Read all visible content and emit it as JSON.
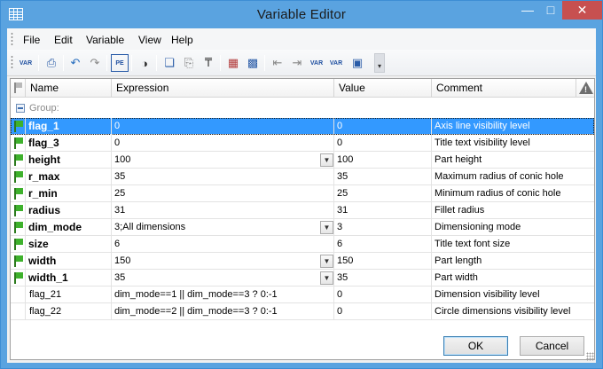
{
  "window": {
    "title": "Variable Editor"
  },
  "menu": [
    "File",
    "Edit",
    "Variable",
    "View",
    "Help"
  ],
  "toolbar": {
    "icons": [
      "add-variable",
      "print",
      "undo",
      "redo",
      "properties",
      "find",
      "copy",
      "paste",
      "clear-format",
      "table-view-1",
      "table-view-2",
      "move-down",
      "move-up",
      "variable-a",
      "variable-b",
      "window"
    ],
    "label_var": "VAR",
    "label_pe": "PE"
  },
  "columns": [
    "Name",
    "Expression",
    "Value",
    "Comment"
  ],
  "group_label": "Group:",
  "rows": [
    {
      "name": "flag_1",
      "expression": "0",
      "value": "0",
      "comment": "Axis line visibility level",
      "flag": true,
      "dropdown": false,
      "selected": true
    },
    {
      "name": "flag_3",
      "expression": "0",
      "value": "0",
      "comment": "Title text visibility level",
      "flag": true,
      "dropdown": false
    },
    {
      "name": "height",
      "expression": "100",
      "value": "100",
      "comment": "Part height",
      "flag": true,
      "dropdown": true
    },
    {
      "name": "r_max",
      "expression": "35",
      "value": "35",
      "comment": "Maximum radius of conic hole",
      "flag": true,
      "dropdown": false
    },
    {
      "name": "r_min",
      "expression": "25",
      "value": "25",
      "comment": "Minimum radius of conic hole",
      "flag": true,
      "dropdown": false
    },
    {
      "name": "radius",
      "expression": "31",
      "value": "31",
      "comment": "Fillet radius",
      "flag": true,
      "dropdown": false
    },
    {
      "name": "dim_mode",
      "expression": "3;All dimensions",
      "value": "3",
      "comment": "Dimensioning mode",
      "flag": true,
      "dropdown": true
    },
    {
      "name": "size",
      "expression": "6",
      "value": "6",
      "comment": "Title text font size",
      "flag": true,
      "dropdown": false
    },
    {
      "name": "width",
      "expression": "150",
      "value": "150",
      "comment": "Part length",
      "flag": true,
      "dropdown": true
    },
    {
      "name": "width_1",
      "expression": "35",
      "value": "35",
      "comment": "Part width",
      "flag": true,
      "dropdown": true
    },
    {
      "name": "flag_21",
      "expression": "dim_mode==1 || dim_mode==3 ? 0:-1",
      "value": "0",
      "comment": "Dimension visibility level",
      "flag": false,
      "dropdown": false
    },
    {
      "name": "flag_22",
      "expression": "dim_mode==2 || dim_mode==3 ? 0:-1",
      "value": "0",
      "comment": "Circle dimensions visibility level",
      "flag": false,
      "dropdown": false
    }
  ],
  "buttons": {
    "ok": "OK",
    "cancel": "Cancel"
  },
  "colors": {
    "titlebar": "#5aa3e0",
    "selection": "#3399ff",
    "close": "#c75050",
    "flag": "#3eb12c"
  }
}
